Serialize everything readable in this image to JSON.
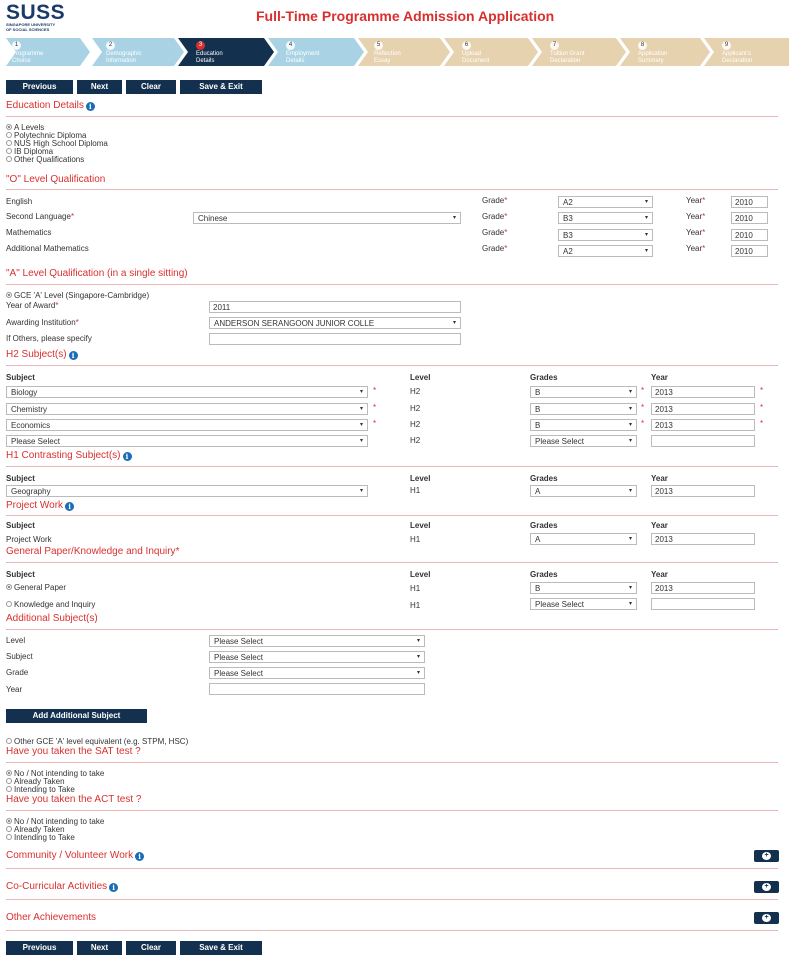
{
  "header": {
    "logo_main": "SUSS",
    "logo_sub1": "SINGAPORE UNIVERSITY",
    "logo_sub2": "OF SOCIAL SCIENCES",
    "title": "Full-Time Programme Admission Application"
  },
  "steps": [
    {
      "num": "1",
      "line1": "Programme",
      "line2": "Choice"
    },
    {
      "num": "2",
      "line1": "Demographic",
      "line2": "Information"
    },
    {
      "num": "3",
      "line1": "Education",
      "line2": "Details"
    },
    {
      "num": "4",
      "line1": "Employment",
      "line2": "Details"
    },
    {
      "num": "5",
      "line1": "Reflection",
      "line2": "Essay"
    },
    {
      "num": "6",
      "line1": "Upload",
      "line2": "Document"
    },
    {
      "num": "7",
      "line1": "Tuition Grant",
      "line2": "Declaration"
    },
    {
      "num": "8",
      "line1": "Application",
      "line2": "Summary"
    },
    {
      "num": "9",
      "line1": "Applicant's",
      "line2": "Declaration"
    }
  ],
  "nav": {
    "previous": "Previous",
    "next": "Next",
    "clear": "Clear",
    "save_exit": "Save & Exit"
  },
  "education": {
    "title": "Education Details",
    "options": [
      "A Levels",
      "Polytechnic Diploma",
      "NUS High School Diploma",
      "IB Diploma",
      "Other Qualifications"
    ]
  },
  "olevel": {
    "title": "\"O\" Level Qualification",
    "grade_label": "Grade",
    "year_label": "Year",
    "rows": [
      {
        "subject": "English",
        "grade": "A2",
        "year": "2010"
      },
      {
        "subject": "Second Language",
        "language": "Chinese",
        "grade": "B3",
        "year": "2010"
      },
      {
        "subject": "Mathematics",
        "grade": "B3",
        "year": "2010"
      },
      {
        "subject": "Additional Mathematics",
        "grade": "A2",
        "year": "2010"
      }
    ]
  },
  "alevel": {
    "title": "\"A\" Level Qualification (in a single sitting)",
    "gce_option": "GCE 'A' Level (Singapore-Cambridge)",
    "year_award_label": "Year of Award",
    "year_award": "2011",
    "institution_label": "Awarding Institution",
    "institution": "ANDERSON SERANGOON JUNIOR COLLE",
    "others_label": "If Others, please specify"
  },
  "cols": {
    "subject": "Subject",
    "level": "Level",
    "grades": "Grades",
    "year": "Year"
  },
  "h2": {
    "title": "H2 Subject(s)",
    "rows": [
      {
        "subject": "Biology",
        "level": "H2",
        "grade": "B",
        "year": "2013"
      },
      {
        "subject": "Chemistry",
        "level": "H2",
        "grade": "B",
        "year": "2013"
      },
      {
        "subject": "Economics",
        "level": "H2",
        "grade": "B",
        "year": "2013"
      },
      {
        "subject": "Please Select",
        "level": "H2",
        "grade": "Please Select",
        "year": ""
      }
    ]
  },
  "h1": {
    "title": "H1 Contrasting Subject(s)",
    "row": {
      "subject": "Geography",
      "level": "H1",
      "grade": "A",
      "year": "2013"
    }
  },
  "project": {
    "title": "Project Work",
    "row": {
      "subject": "Project Work",
      "level": "H1",
      "grade": "A",
      "year": "2013"
    }
  },
  "gp": {
    "title": "General Paper/Knowledge and Inquiry",
    "rows": [
      {
        "subject": "General Paper",
        "level": "H1",
        "grade": "B",
        "year": "2013"
      },
      {
        "subject": "Knowledge and Inquiry",
        "level": "H1",
        "grade": "Please Select",
        "year": ""
      }
    ]
  },
  "additional": {
    "title": "Additional Subject(s)",
    "level_label": "Level",
    "subject_label": "Subject",
    "grade_label": "Grade",
    "year_label": "Year",
    "level": "Please Select",
    "subject": "Please Select",
    "grade": "Please Select",
    "add_button": "Add Additional Subject"
  },
  "other_gce": "Other GCE 'A' level equivalent (e.g. STPM, HSC)",
  "sat": {
    "title": "Have you taken the SAT test ?",
    "options": [
      "No / Not intending to take",
      "Already Taken",
      "Intending to Take"
    ]
  },
  "act": {
    "title": "Have you taken the ACT test ?",
    "options": [
      "No / Not intending to take",
      "Already Taken",
      "Intending to Take"
    ]
  },
  "sections": {
    "community": "Community / Volunteer Work",
    "cca": "Co-Curricular Activities",
    "achievements": "Other Achievements"
  },
  "icons": {
    "info": "i",
    "add": "+",
    "chevron": "▾"
  }
}
